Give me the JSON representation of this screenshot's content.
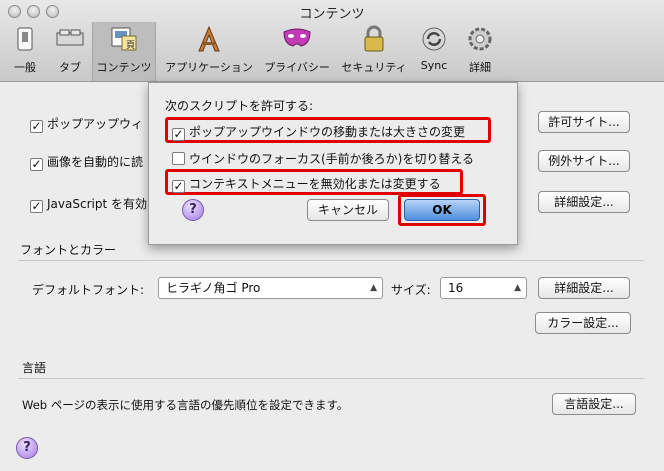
{
  "window": {
    "title": "コンテンツ"
  },
  "toolbar": {
    "items": [
      {
        "label": "一般",
        "icon": "switch-icon"
      },
      {
        "label": "タブ",
        "icon": "tabs-icon"
      },
      {
        "label": "コンテンツ",
        "icon": "content-icon"
      },
      {
        "label": "アプリケーション",
        "icon": "applications-icon"
      },
      {
        "label": "プライバシー",
        "icon": "privacy-mask-icon"
      },
      {
        "label": "セキュリティ",
        "icon": "lock-icon"
      },
      {
        "label": "Sync",
        "icon": "sync-icon"
      },
      {
        "label": "詳細",
        "icon": "gear-icon"
      }
    ]
  },
  "content": {
    "popups": {
      "label": "ポップアップウィ",
      "checked": true,
      "button": "許可サイト..."
    },
    "images": {
      "label": "画像を自動的に読",
      "checked": true,
      "button": "例外サイト..."
    },
    "javascript": {
      "label": "JavaScript を有効",
      "checked": true,
      "button": "詳細設定..."
    }
  },
  "fonts": {
    "section_title": "フォントとカラー",
    "default_font_label": "デフォルトフォント:",
    "default_font_value": "ヒラギノ角ゴ Pro",
    "size_label": "サイズ:",
    "size_value": "16",
    "advanced_button": "詳細設定...",
    "colors_button": "カラー設定..."
  },
  "language": {
    "section_title": "言語",
    "description": "Web ページの表示に使用する言語の優先順位を設定できます。",
    "button": "言語設定..."
  },
  "sheet": {
    "heading": "次のスクリプトを許可する:",
    "options": [
      {
        "label": "ポップアップウインドウの移動または大きさの変更",
        "checked": true
      },
      {
        "label": "ウインドウのフォーカス(手前か後ろか)を切り替える",
        "checked": false
      },
      {
        "label": "コンテキストメニューを無効化または変更する",
        "checked": true
      }
    ],
    "cancel": "キャンセル",
    "ok": "OK",
    "highlight_color": "#e00000"
  },
  "help_glyph": "?",
  "check_glyph": "✓"
}
